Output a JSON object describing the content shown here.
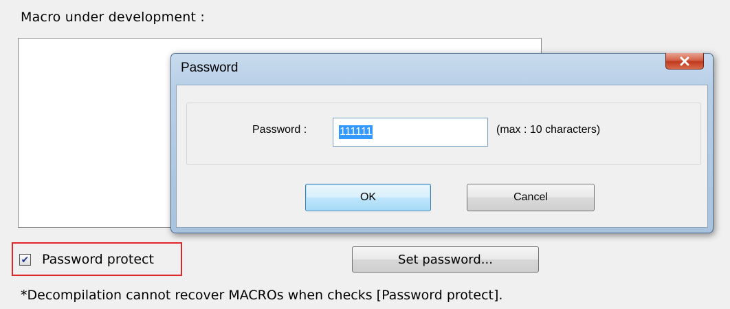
{
  "section": {
    "label": "Macro under development :"
  },
  "options": {
    "password_protect_label": "Password protect",
    "password_protect_checked": true,
    "set_password_label": "Set password..."
  },
  "note": "*Decompilation cannot recover MACROs when checks [Password protect].",
  "dialog": {
    "title": "Password",
    "close_glyph": "X",
    "password_label": "Password :",
    "password_value": "111111",
    "hint": "(max : 10 characters)",
    "ok_label": "OK",
    "cancel_label": "Cancel"
  },
  "icons": {
    "checkbox": "check-icon",
    "close": "close-icon"
  },
  "colors": {
    "highlight_frame": "#e0262b",
    "close_button": "#c03a1e",
    "selection": "#3399ff"
  }
}
